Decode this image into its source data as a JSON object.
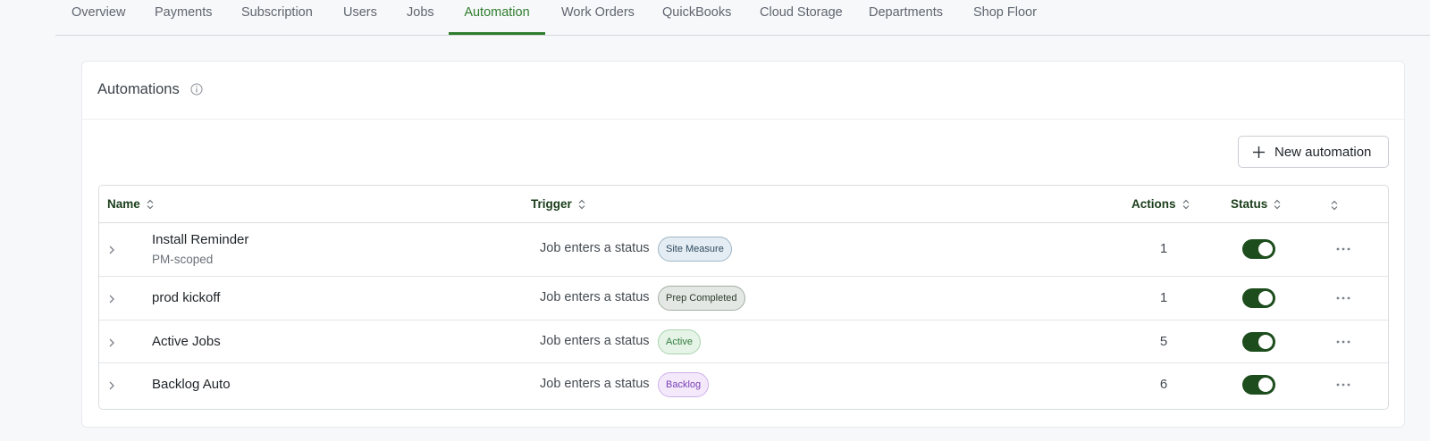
{
  "tabs": [
    {
      "label": "Overview",
      "active": false
    },
    {
      "label": "Payments",
      "active": false
    },
    {
      "label": "Subscription",
      "active": false
    },
    {
      "label": "Users",
      "active": false
    },
    {
      "label": "Jobs",
      "active": false
    },
    {
      "label": "Automation",
      "active": true
    },
    {
      "label": "Work Orders",
      "active": false
    },
    {
      "label": "QuickBooks",
      "active": false
    },
    {
      "label": "Cloud Storage",
      "active": false
    },
    {
      "label": "Departments",
      "active": false
    },
    {
      "label": "Shop Floor",
      "active": false
    }
  ],
  "card": {
    "title": "Automations",
    "info_icon": "info-icon",
    "new_button_label": "New automation"
  },
  "table": {
    "headers": {
      "name": "Name",
      "trigger": "Trigger",
      "actions": "Actions",
      "status": "Status"
    },
    "rows": [
      {
        "name": "Install Reminder",
        "subtitle": "PM-scoped",
        "trigger": "Job enters a status",
        "badge": "Site Measure",
        "badge_colors": {
          "bg": "#e4edf3",
          "border": "#9fb5c5",
          "text": "#2e4a60"
        },
        "actions": "1",
        "enabled": true
      },
      {
        "name": "prod kickoff",
        "subtitle": "",
        "trigger": "Job enters a status",
        "badge": "Prep Completed",
        "badge_colors": {
          "bg": "#e4e8e4",
          "border": "#a3aea3",
          "text": "#2c3a2c"
        },
        "actions": "1",
        "enabled": true
      },
      {
        "name": "Active Jobs",
        "subtitle": "",
        "trigger": "Job enters a status",
        "badge": "Active",
        "badge_colors": {
          "bg": "#e6f4e8",
          "border": "#a8d3ae",
          "text": "#2f7d3a"
        },
        "actions": "5",
        "enabled": true
      },
      {
        "name": "Backlog Auto",
        "subtitle": "",
        "trigger": "Job enters a status",
        "badge": "Backlog",
        "badge_colors": {
          "bg": "#f3e9fb",
          "border": "#cfb1ea",
          "text": "#7a3fb5"
        },
        "actions": "6",
        "enabled": true
      }
    ]
  },
  "colors": {
    "accent": "#2f7d2f",
    "toggle_on": "#1d4d1d",
    "header_text": "#1a3d1a"
  }
}
